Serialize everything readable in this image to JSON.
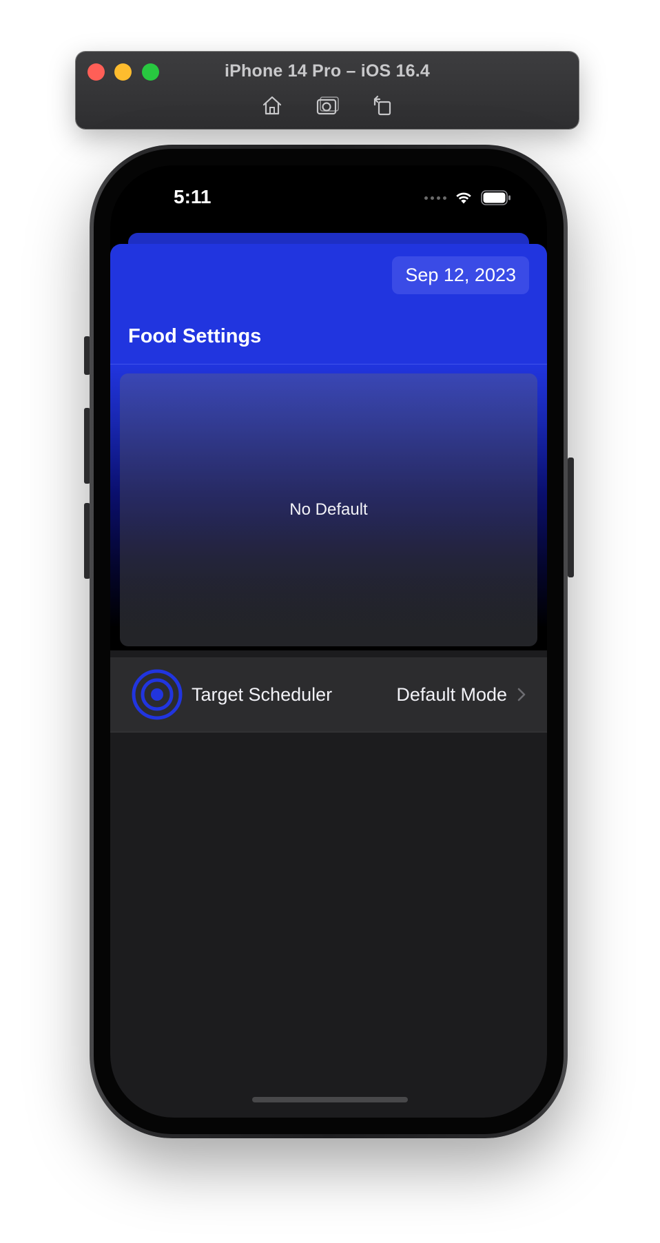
{
  "simulator": {
    "title": "iPhone 14 Pro – iOS 16.4",
    "toolbar": [
      {
        "icon": "home-icon"
      },
      {
        "icon": "screenshot-icon"
      },
      {
        "icon": "rotate-icon"
      }
    ]
  },
  "status_bar": {
    "time": "5:11"
  },
  "header": {
    "date": "Sep 12, 2023",
    "title": "Food Settings"
  },
  "default_card": {
    "label": "No Default"
  },
  "settings_row": {
    "icon": "target-icon",
    "label": "Target Scheduler",
    "value": "Default Mode"
  },
  "colors": {
    "accent": "#2135df",
    "background": "#1c1c1e",
    "row_background": "#2c2c2e"
  }
}
